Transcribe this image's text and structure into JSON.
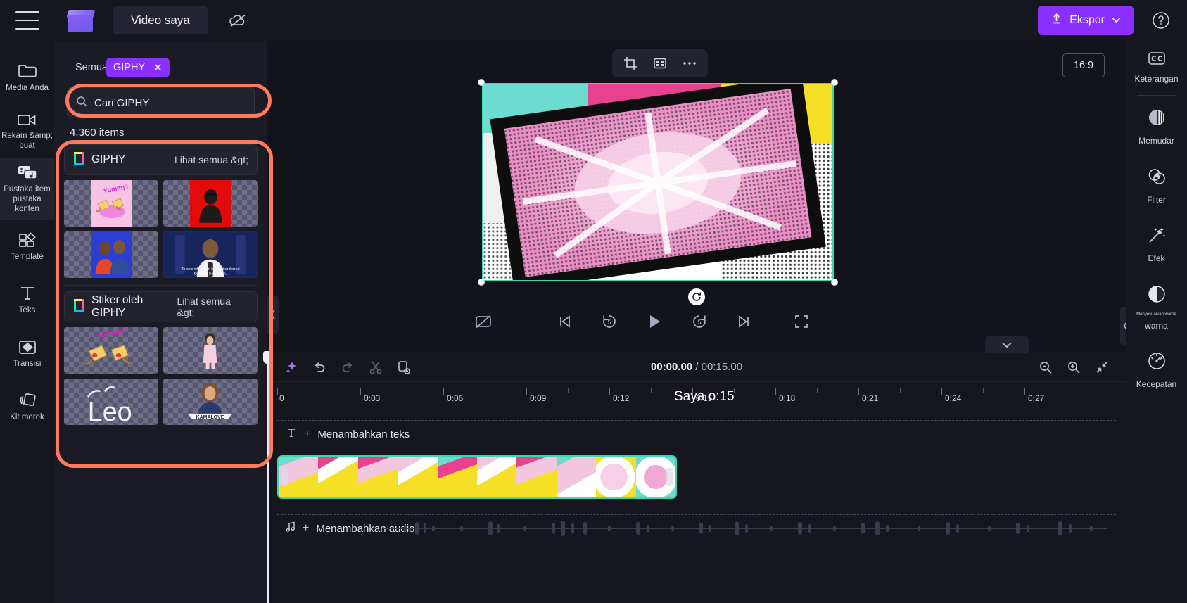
{
  "topbar": {
    "menu_icon": "hamburger-icon",
    "logo_icon": "clipchamp-logo",
    "project_title": "Video saya",
    "cloud_icon": "cloud-off-icon",
    "export_label": "Ekspor",
    "export_icon": "upload-icon",
    "export_chevron": "chevron-down-icon",
    "help_icon": "question-circle-icon"
  },
  "left_rail": {
    "items": [
      {
        "label": "Media Anda",
        "icon": "folder-icon",
        "active": false
      },
      {
        "label": "Rekam &amp; buat",
        "icon": "video-camera-icon",
        "active": false
      },
      {
        "label": "Pustaka item pustaka konten",
        "icon": "content-library-icon",
        "active": true
      },
      {
        "label": "Template",
        "icon": "template-icon",
        "active": false
      },
      {
        "label": "Teks",
        "icon": "text-icon",
        "active": false
      },
      {
        "label": "Transisi",
        "icon": "transition-icon",
        "active": false
      },
      {
        "label": "Kit merek",
        "icon": "brand-kit-icon",
        "active": false
      }
    ]
  },
  "panel": {
    "filter_all_label": "Semua",
    "chip_label": "GIPHY",
    "chip_close_icon": "close-icon",
    "search": {
      "value": "Cari GIPHY",
      "placeholder": "Cari GIPHY",
      "icon": "search-icon"
    },
    "items_count_number": "4,360",
    "items_count_label": "items",
    "sections": [
      {
        "title": "GIPHY",
        "see_all": "Lihat semua &gt;",
        "icon": "giphy-icon",
        "tiles": [
          {
            "name": "tile-taco-yummy"
          },
          {
            "name": "tile-person-red-bg"
          },
          {
            "name": "tile-two-women-blue"
          },
          {
            "name": "tile-speaker-podium"
          }
        ]
      },
      {
        "title": "Stiker oleh GIPHY",
        "see_all": "Lihat semua &gt;",
        "icon": "giphy-icon",
        "tiles": [
          {
            "name": "sticker-taco-yummy"
          },
          {
            "name": "sticker-pink-outfit"
          },
          {
            "name": "sticker-leo-text"
          },
          {
            "name": "sticker-kamalove-banner"
          }
        ]
      }
    ],
    "collapse_icon": "chevron-left-icon"
  },
  "preview": {
    "toolbar": [
      {
        "name": "crop-button",
        "icon": "crop-icon"
      },
      {
        "name": "fit-button",
        "icon": "fit-to-frame-icon"
      },
      {
        "name": "more-button",
        "icon": "ellipsis-icon"
      }
    ],
    "aspect_ratio": "16:9",
    "rotate_icon": "rotate-icon",
    "controls": [
      {
        "name": "captions-off-button",
        "icon": "cc-off-icon"
      },
      {
        "name": "skip-start-button",
        "icon": "skip-to-start-icon"
      },
      {
        "name": "rewind-5-button",
        "icon": "rewind-5-icon",
        "label": "5"
      },
      {
        "name": "play-button",
        "icon": "play-icon"
      },
      {
        "name": "forward-5-button",
        "icon": "forward-5-icon",
        "label": "5"
      },
      {
        "name": "skip-end-button",
        "icon": "skip-to-end-icon"
      },
      {
        "name": "fullscreen-button",
        "icon": "fullscreen-icon"
      }
    ],
    "collapse_icon": "chevron-left-icon",
    "expand_timeline_icon": "chevron-down-icon"
  },
  "timeline": {
    "tools": [
      {
        "name": "magic-button",
        "icon": "sparkle-icon",
        "enabled": true
      },
      {
        "name": "undo-button",
        "icon": "undo-icon",
        "enabled": true
      },
      {
        "name": "redo-button",
        "icon": "redo-icon",
        "enabled": false
      },
      {
        "name": "split-button",
        "icon": "scissors-icon",
        "enabled": false
      },
      {
        "name": "duplicate-button",
        "icon": "duplicate-icon",
        "enabled": true
      }
    ],
    "current_time": "00:00.00",
    "total_time": "/ 00:15.00",
    "zoom_out_icon": "zoom-out-icon",
    "zoom_in_icon": "zoom-in-icon",
    "fit_icon": "fit-timeline-icon",
    "ruler_ticks": [
      "0",
      "0:03",
      "0:06",
      "0:09",
      "0:12",
      "0:15",
      "0:18",
      "0:21",
      "0:24",
      "0:27"
    ],
    "overlay_text": "Saya o:15",
    "text_track_label": "Menambahkan teks",
    "text_track_icon": "text-icon",
    "audio_track_label": "Menambahkan audio",
    "audio_track_icon": "music-note-icon"
  },
  "right_rail": {
    "items": [
      {
        "label": "Keterangan",
        "icon": "cc-icon",
        "sublabel": ""
      },
      {
        "label": "Memudar",
        "icon": "fade-icon",
        "sublabel": ""
      },
      {
        "label": "Filter",
        "icon": "filter-icon",
        "sublabel": ""
      },
      {
        "label": "Efek",
        "icon": "magic-wand-icon",
        "sublabel": ""
      },
      {
        "label": "warna",
        "icon": "adjust-colors-icon",
        "sublabel": "Menyesuaikan warna"
      },
      {
        "label": "Kecepatan",
        "icon": "speed-gauge-icon",
        "sublabel": ""
      }
    ]
  },
  "colors": {
    "accent_purple": "#8b2fff",
    "highlight_orange": "#ff7a5e",
    "clip_teal": "#3ed6b0",
    "bg_dark": "#13131c",
    "panel_bg": "#1b1b26"
  }
}
